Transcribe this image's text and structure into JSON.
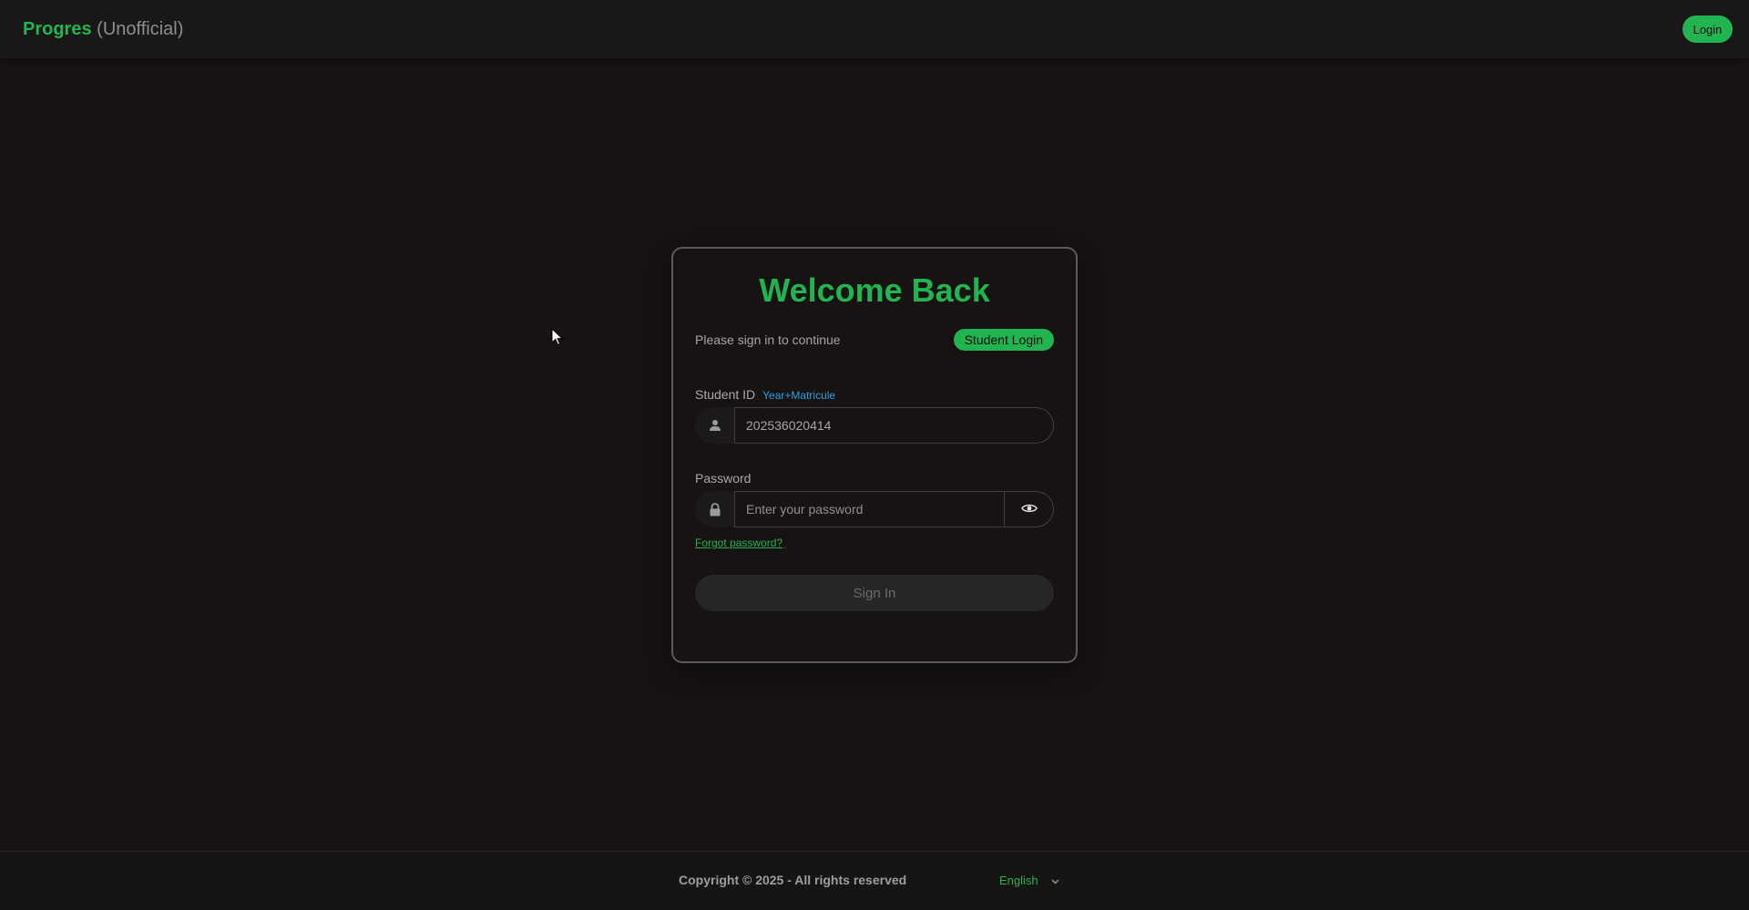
{
  "header": {
    "brand_name": "Progres",
    "brand_sub": "(Unofficial)",
    "login_label": "Login"
  },
  "card": {
    "title": "Welcome Back",
    "subtitle": "Please sign in to continue",
    "badge": "Student Login",
    "student_id": {
      "label": "Student ID",
      "hint": "Year+Matricule",
      "value": "202536020414",
      "icon": "user-icon"
    },
    "password": {
      "label": "Password",
      "placeholder": "Enter your password",
      "icon": "lock-icon",
      "toggle_icon": "eye-icon"
    },
    "forgot": "Forgot password?",
    "submit": "Sign In"
  },
  "footer": {
    "copyright": "Copyright © 2025 - All rights reserved",
    "language": "English"
  },
  "colors": {
    "accent": "#22b451",
    "background": "#161312",
    "hint": "#2aa0e0"
  }
}
